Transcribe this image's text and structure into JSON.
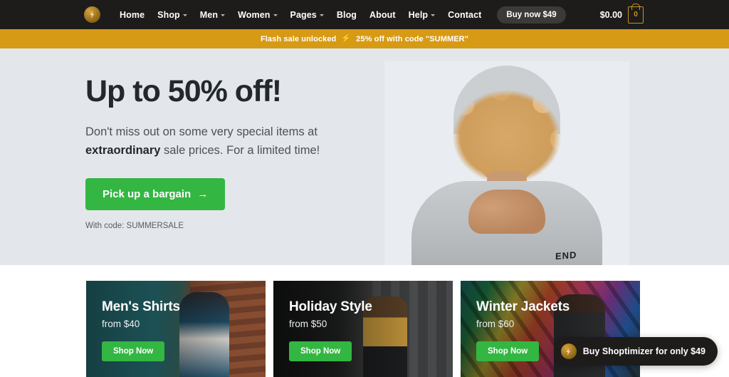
{
  "topnav": {
    "logo_icon": "lightning-bolt-logo",
    "items": [
      {
        "label": "Home",
        "has_dropdown": false
      },
      {
        "label": "Shop",
        "has_dropdown": true
      },
      {
        "label": "Men",
        "has_dropdown": true
      },
      {
        "label": "Women",
        "has_dropdown": true
      },
      {
        "label": "Pages",
        "has_dropdown": true
      },
      {
        "label": "Blog",
        "has_dropdown": false
      },
      {
        "label": "About",
        "has_dropdown": false
      },
      {
        "label": "Help",
        "has_dropdown": true
      },
      {
        "label": "Contact",
        "has_dropdown": false
      }
    ],
    "buy_now_label": "Buy now $49",
    "cart": {
      "total": "$0.00",
      "count": "0",
      "icon": "shopping-bag-icon"
    },
    "bg_color": "#1d1c1a"
  },
  "announcement": {
    "text_before": "Flash sale unlocked",
    "bolt_icon": "⚡",
    "text_after": "25% off with code \"SUMMER\"",
    "bg_color": "#d79a15"
  },
  "hero": {
    "heading": "Up to 50% off!",
    "subtitle_part1": "Don't miss out on some very special items at ",
    "subtitle_emphasis": "extraordinary",
    "subtitle_part2": " sale prices. For a limited time!",
    "cta_label": "Pick up a bargain",
    "cta_arrow": "→",
    "code_note": "With code: SUMMERSALE",
    "bg_color": "#e3e7ec",
    "accent_color": "#33b642",
    "image_alt": "laughing-woman-curly-hair-grey-hoodie",
    "hoodie_text": "END"
  },
  "cards": [
    {
      "title": "Men's Shirts",
      "price": "from $40",
      "button_label": "Shop Now",
      "image_alt": "man-in-open-shirt-city-street"
    },
    {
      "title": "Holiday Style",
      "price": "from $50",
      "button_label": "Shop Now",
      "image_alt": "woman-yellow-jacket-cobblestone-street"
    },
    {
      "title": "Winter Jackets",
      "price": "from $60",
      "button_label": "Shop Now",
      "image_alt": "man-leather-jacket-graffiti-wall"
    }
  ],
  "float_badge": {
    "label": "Buy Shoptimizer for only $49",
    "icon": "lightning-bolt-logo"
  }
}
